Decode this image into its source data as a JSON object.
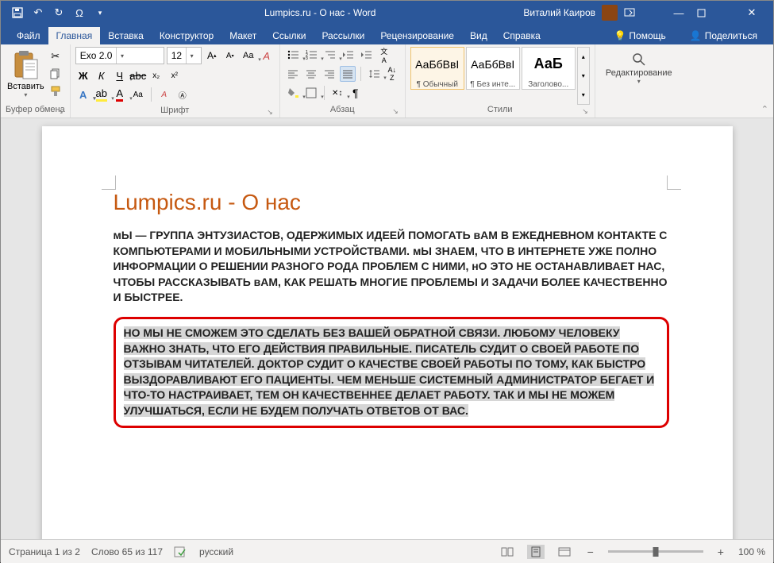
{
  "window": {
    "title": "Lumpics.ru - О нас  -  Word",
    "user_name": "Виталий Каиров"
  },
  "tabs": {
    "file": "Файл",
    "home": "Главная",
    "insert": "Вставка",
    "design": "Конструктор",
    "layout": "Макет",
    "references": "Ссылки",
    "mailings": "Рассылки",
    "review": "Рецензирование",
    "view": "Вид",
    "help": "Справка",
    "tell_me": "Помощь",
    "share": "Поделиться"
  },
  "ribbon": {
    "clipboard": {
      "paste": "Вставить",
      "label": "Буфер обмена"
    },
    "font": {
      "name": "Exo 2.0",
      "size": "12",
      "label": "Шрифт"
    },
    "paragraph": {
      "label": "Абзац"
    },
    "styles": {
      "label": "Стили",
      "items": [
        {
          "preview": "АаБбВвІ",
          "name": "¶ Обычный"
        },
        {
          "preview": "АаБбВвІ",
          "name": "¶ Без инте..."
        },
        {
          "preview": "АаБ",
          "name": "Заголово..."
        }
      ]
    },
    "editing": {
      "label": "Редактирование"
    }
  },
  "document": {
    "title": "Lumpics.ru - О нас",
    "para1": "мЫ — ГРУППА ЭНТУЗИАСТОВ, ОДЕРЖИМЫХ ИДЕЕЙ ПОМОГАТЬ вАМ В ЕЖЕДНЕВНОМ КОНТАКТЕ С КОМПЬЮТЕРАМИ И МОБИЛЬНЫМИ УСТРОЙСТВАМИ. мЫ ЗНАЕМ, ЧТО В ИНТЕРНЕТЕ УЖЕ ПОЛНО ИНФОРМАЦИИ О РЕШЕНИИ РАЗНОГО РОДА ПРОБЛЕМ С НИМИ, нО ЭТО НЕ ОСТАНАВЛИВАЕТ НАС, ЧТОБЫ РАССКАЗЫВАТЬ вАМ, КАК РЕШАТЬ МНОГИЕ ПРОБЛЕМЫ И ЗАДАЧИ БОЛЕЕ КАЧЕСТВЕННО И БЫСТРЕЕ.",
    "para2": "НО МЫ НЕ СМОЖЕМ ЭТО СДЕЛАТЬ БЕЗ ВАШЕЙ ОБРАТНОЙ СВЯЗИ. ЛЮБОМУ ЧЕЛОВЕКУ ВАЖНО ЗНАТЬ, ЧТО ЕГО ДЕЙСТВИЯ ПРАВИЛЬНЫЕ. ПИСАТЕЛЬ СУДИТ О СВОЕЙ РАБОТЕ ПО ОТЗЫВАМ ЧИТАТЕЛЕЙ. ДОКТОР СУДИТ О КАЧЕСТВЕ СВОЕЙ РАБОТЫ ПО ТОМУ, КАК БЫСТРО ВЫЗДОРАВЛИВАЮТ ЕГО ПАЦИЕНТЫ. ЧЕМ МЕНЬШЕ СИСТЕМНЫЙ АДМИНИСТРАТОР БЕГАЕТ И ЧТО-ТО НАСТРАИВАЕТ, ТЕМ ОН КАЧЕСТВЕННЕЕ ДЕЛАЕТ РАБОТУ. ТАК И МЫ НЕ МОЖЕМ УЛУЧШАТЬСЯ, ЕСЛИ НЕ БУДЕМ ПОЛУЧАТЬ ОТВЕТОВ ОТ ВАС."
  },
  "status": {
    "page": "Страница 1 из 2",
    "words": "Слово 65 из 117",
    "lang": "русский",
    "zoom": "100 %"
  }
}
